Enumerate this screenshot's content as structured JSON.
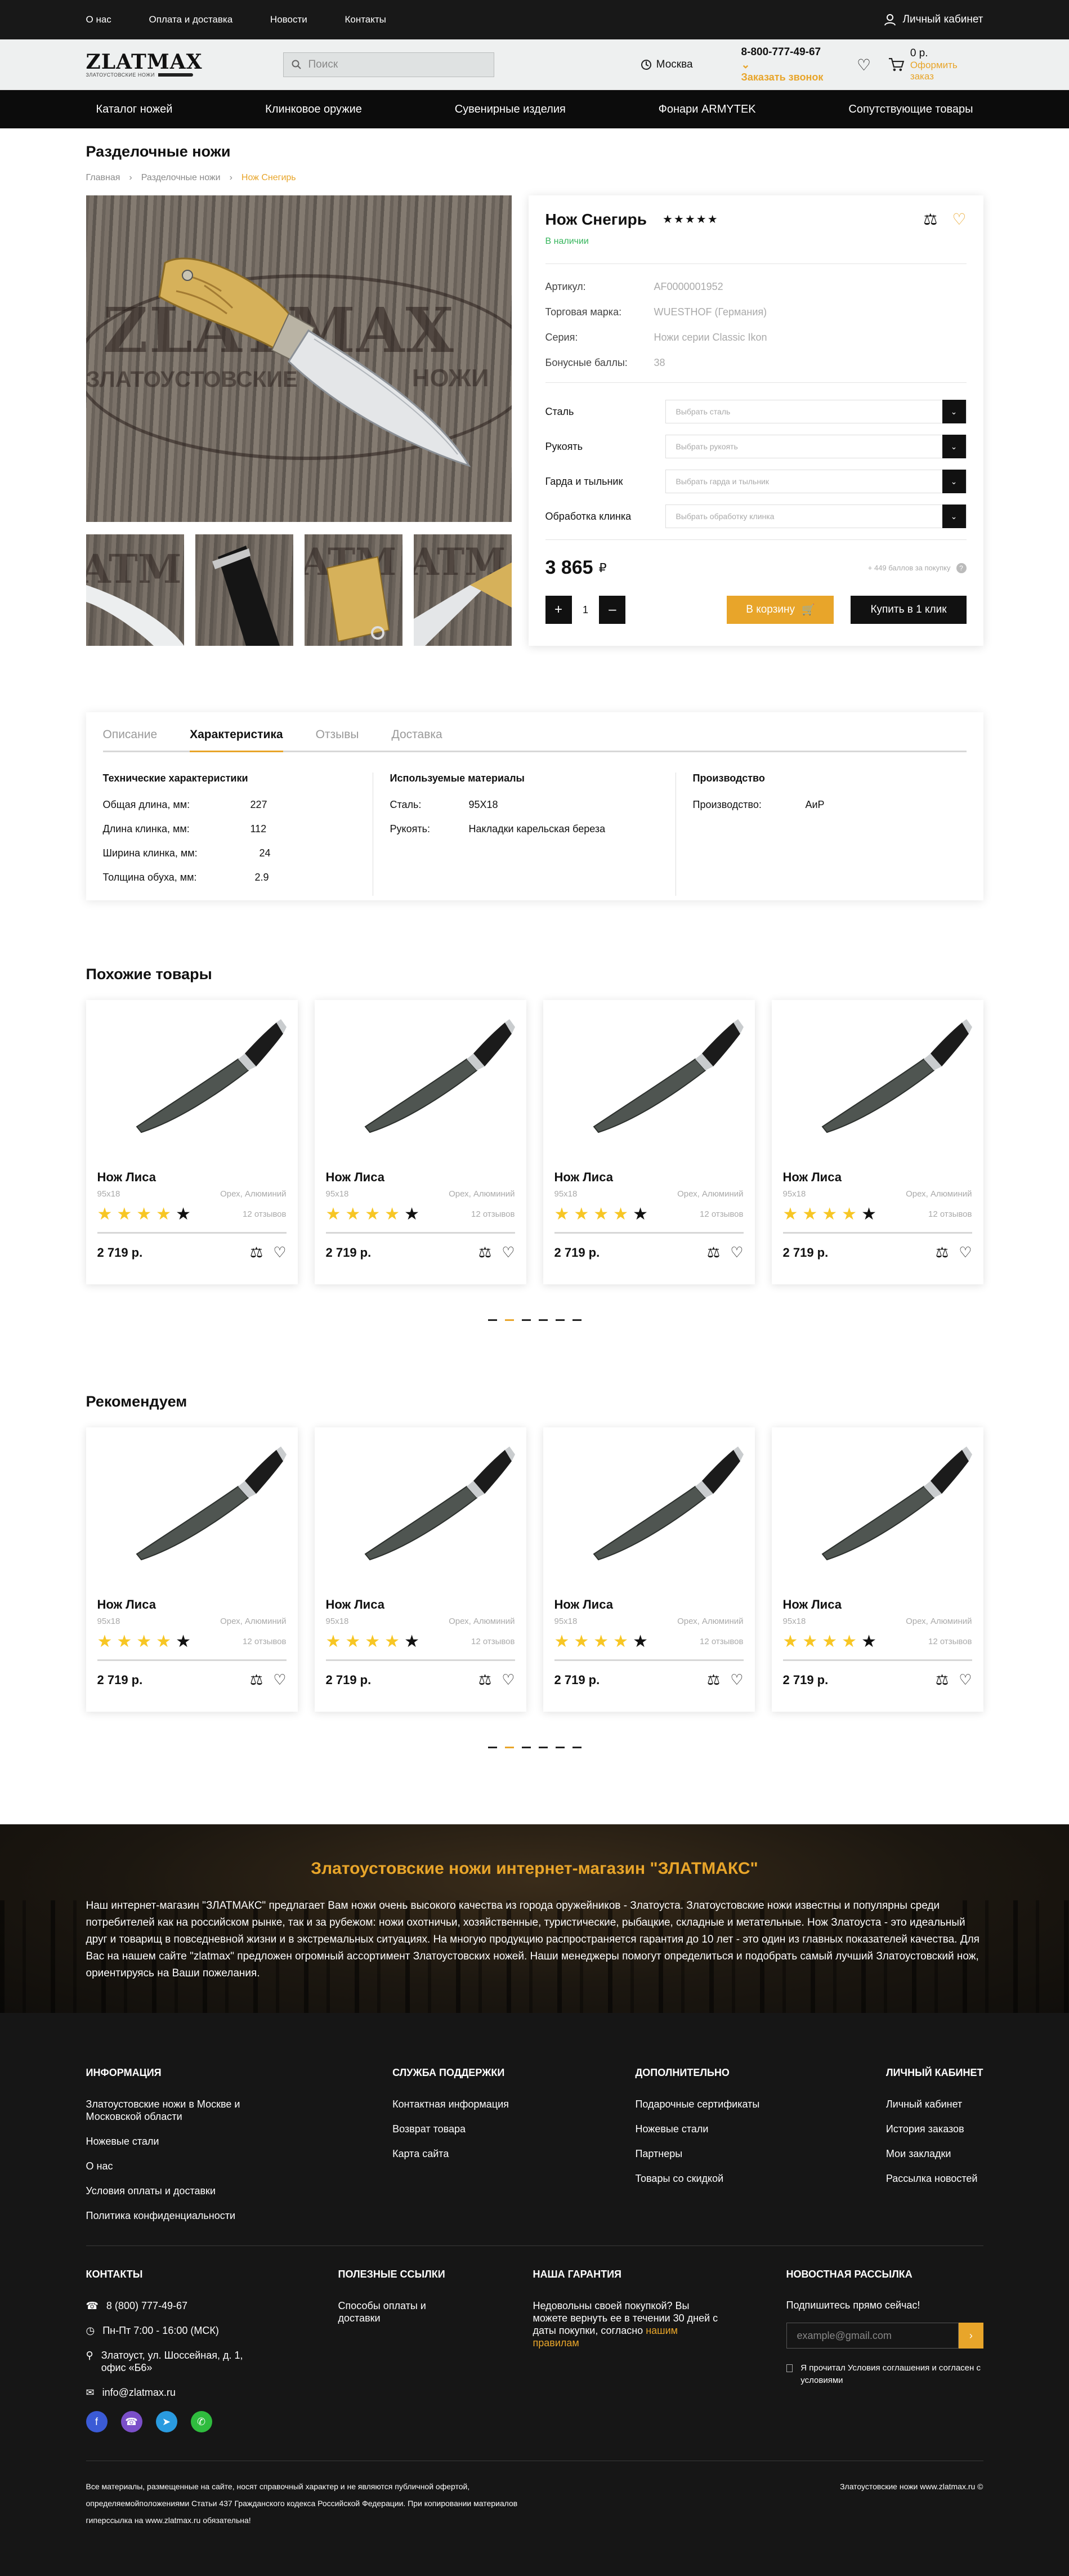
{
  "topbar": {
    "links": [
      "О нас",
      "Оплата и доставка",
      "Новости",
      "Контакты"
    ],
    "cabinet": "Личный кабинет"
  },
  "header": {
    "logo_main": "ZLATMAX",
    "logo_sub": "ЗЛАТОУСТОВСКИЕ НОЖИ",
    "search_placeholder": "Поиск",
    "city": "Москва",
    "phone": "8-800-777-49-67",
    "call": "Заказать звонок",
    "cart_sum": "0 р.",
    "cart_order": "Оформить заказ"
  },
  "nav": [
    "Каталог ножей",
    "Клинковое оружие",
    "Сувенирные изделия",
    "Фонари ARMYTEK",
    "Сопутствующие товары"
  ],
  "page": {
    "title": "Разделочные ножи",
    "breadcrumbs": [
      "Главная",
      "Разделочные ножи",
      "Нож Снегирь"
    ]
  },
  "gallery": {
    "watermark_main": "ZLATMAX",
    "watermark_left": "ЗЛАТОУСТОВСКИЕ",
    "watermark_right": "НОЖИ",
    "thumbs_text": "ATM"
  },
  "product": {
    "name": "Нож Снегирь",
    "rating": 5,
    "availability": "В наличии",
    "props": [
      {
        "k": "Артикул:",
        "v": "AF0000001952"
      },
      {
        "k": "Торговая марка:",
        "v": "WUESTHOF (Германия)"
      },
      {
        "k": "Серия:",
        "v": "Ножи серии Classic Ikon"
      },
      {
        "k": "Бонусные баллы:",
        "v": "38"
      }
    ],
    "options": [
      {
        "label": "Сталь",
        "placeholder": "Выбрать сталь"
      },
      {
        "label": "Рукоять",
        "placeholder": "Выбрать рукоять"
      },
      {
        "label": "Гарда и тыльник",
        "placeholder": "Выбрать гарда и тыльник"
      },
      {
        "label": "Обработка клинка",
        "placeholder": "Выбрать обработку клинка"
      }
    ],
    "price": "3 865",
    "currency": "₽",
    "bonus": "+ 449 баллов за покупку",
    "bonus_icon": "?",
    "qty": "1",
    "to_cart": "В корзину",
    "one_click": "Купить в 1 клик"
  },
  "tabs": {
    "labels": [
      "Описание",
      "Характеристика",
      "Отзывы",
      "Доставка"
    ],
    "active": 1,
    "tech": {
      "title": "Технические характеристики",
      "rows": [
        {
          "k": "Общая длина, мм:",
          "v": "227"
        },
        {
          "k": "Длина клинка, мм:",
          "v": "112"
        },
        {
          "k": "Ширина клинка, мм:",
          "v": "24"
        },
        {
          "k": "Толщина обуха, мм:",
          "v": "2.9"
        }
      ]
    },
    "materials": {
      "title": "Используемые материалы",
      "rows": [
        {
          "k": "Сталь:",
          "v": "95X18"
        },
        {
          "k": "Рукоять:",
          "v": "Накладки карельская береза"
        }
      ]
    },
    "production": {
      "title": "Производство",
      "rows": [
        {
          "k": "Производство:",
          "v": "АиР"
        }
      ]
    }
  },
  "similar": {
    "title": "Похожие товары",
    "items": [
      {
        "name": "Нож Лиса",
        "steel": "95x18",
        "handle": "Орех, Алюминий",
        "rating": 4,
        "reviews": "12 отзывов",
        "price": "2 719 р."
      },
      {
        "name": "Нож Лиса",
        "steel": "95x18",
        "handle": "Орех, Алюминий",
        "rating": 4,
        "reviews": "12 отзывов",
        "price": "2 719 р."
      },
      {
        "name": "Нож Лиса",
        "steel": "95x18",
        "handle": "Орех, Алюминий",
        "rating": 4,
        "reviews": "12 отзывов",
        "price": "2 719 р."
      },
      {
        "name": "Нож Лиса",
        "steel": "95x18",
        "handle": "Орех, Алюминий",
        "rating": 4,
        "reviews": "12 отзывов",
        "price": "2 719 р."
      }
    ]
  },
  "recommend": {
    "title": "Рекомендуем",
    "items": [
      {
        "name": "Нож Лиса",
        "steel": "95x18",
        "handle": "Орех, Алюминий",
        "rating": 4,
        "reviews": "12 отзывов",
        "price": "2 719 р."
      },
      {
        "name": "Нож Лиса",
        "steel": "95x18",
        "handle": "Орех, Алюминий",
        "rating": 4,
        "reviews": "12 отзывов",
        "price": "2 719 р."
      },
      {
        "name": "Нож Лиса",
        "steel": "95x18",
        "handle": "Орех, Алюминий",
        "rating": 4,
        "reviews": "12 отзывов",
        "price": "2 719 р."
      },
      {
        "name": "Нож Лиса",
        "steel": "95x18",
        "handle": "Орех, Алюминий",
        "rating": 4,
        "reviews": "12 отзывов",
        "price": "2 719 р."
      }
    ]
  },
  "slider_pages": 6,
  "slider_active": 1,
  "seo": {
    "title": "Златоустовские ножи интернет-магазин \"ЗЛАТМАКС\"",
    "text": "Наш интернет-магазин \"ЗЛАТМАКС\" предлагает Вам ножи очень высокого качества из города оружейников - Златоуста. Златоустовские ножи известны и популярны среди потребителей как на российском рынке, так и за рубежом: ножи охотничьи, хозяйственные, туристические, рыбацкие, складные и метательные. Нож Златоуста - это идеальный друг и товарищ в повседневной жизни и в экстремальных ситуациях. На многую продукцию распространяется гарантия до 10 лет - это один из главных показателей качества. Для Вас на нашем сайте \"zlatmax\" предложен огромный ассортимент Златоустовских ножей. Наши менеджеры помогут определиться и подобрать самый лучший Златоустовский нож, ориентируясь на Ваши пожелания."
  },
  "footer": {
    "cols": [
      {
        "title": "ИНФОРМАЦИЯ",
        "items": [
          "Златоустовские ножи в Москве и Московской области",
          "Ножевые стали",
          "О нас",
          "Условия оплаты и доставки",
          "Политика конфиденциальности"
        ]
      },
      {
        "title": "СЛУЖБА ПОДДЕРЖКИ",
        "items": [
          "Контактная информация",
          "Возврат товара",
          "Карта сайта"
        ]
      },
      {
        "title": "ДОПОЛНИТЕЛЬНО",
        "items": [
          "Подарочные сертификаты",
          "Ножевые стали",
          "Партнеры",
          "Товары со скидкой"
        ]
      },
      {
        "title": "ЛИЧНЫЙ КАБИНЕТ",
        "items": [
          "Личный кабинет",
          "История заказов",
          "Мои закладки",
          "Рассылка новостей"
        ]
      }
    ],
    "contacts": {
      "title": "КОНТАКТЫ",
      "phone": "8 (800) 777-49-67",
      "hours": "Пн-Пт 7:00 - 16:00 (МСК)",
      "address": "Златоуст, ул. Шоссейная, д. 1, офис «Б6»",
      "email": "info@zlatmax.ru"
    },
    "useful": {
      "title": "ПОЛЕЗНЫЕ ССЫЛКИ",
      "items": [
        "Способы оплаты и доставки"
      ]
    },
    "guarantee": {
      "title": "НАША ГАРАНТИЯ",
      "text": "Недовольны своей покупкой? Вы можете вернуть ее в течении 30 дней с даты покупки, согласно",
      "link": "нашим правилам"
    },
    "newsletter": {
      "title": "НОВОСТНАЯ РАССЫЛКА",
      "lead": "Подпишитесь прямо сейчас!",
      "placeholder": "example@gmail.com",
      "agree": "Я прочитал Условия соглашения и согласен с условиями"
    },
    "copyright": "Все материалы, размещенные на сайте, носят справочный характер и не являются публичной офертой, определяемойположениями Статьи 437 Гражданского кодекса Российской Федерации. При копировании материалов гиперссылка на www.zlatmax.ru обязательна!",
    "site": "Златоустовские ножи www.zlatmax.ru ©"
  },
  "colors": {
    "accent": "#e8a52a",
    "dark": "#181818",
    "green": "#36b55c",
    "star": "#f7c624"
  }
}
